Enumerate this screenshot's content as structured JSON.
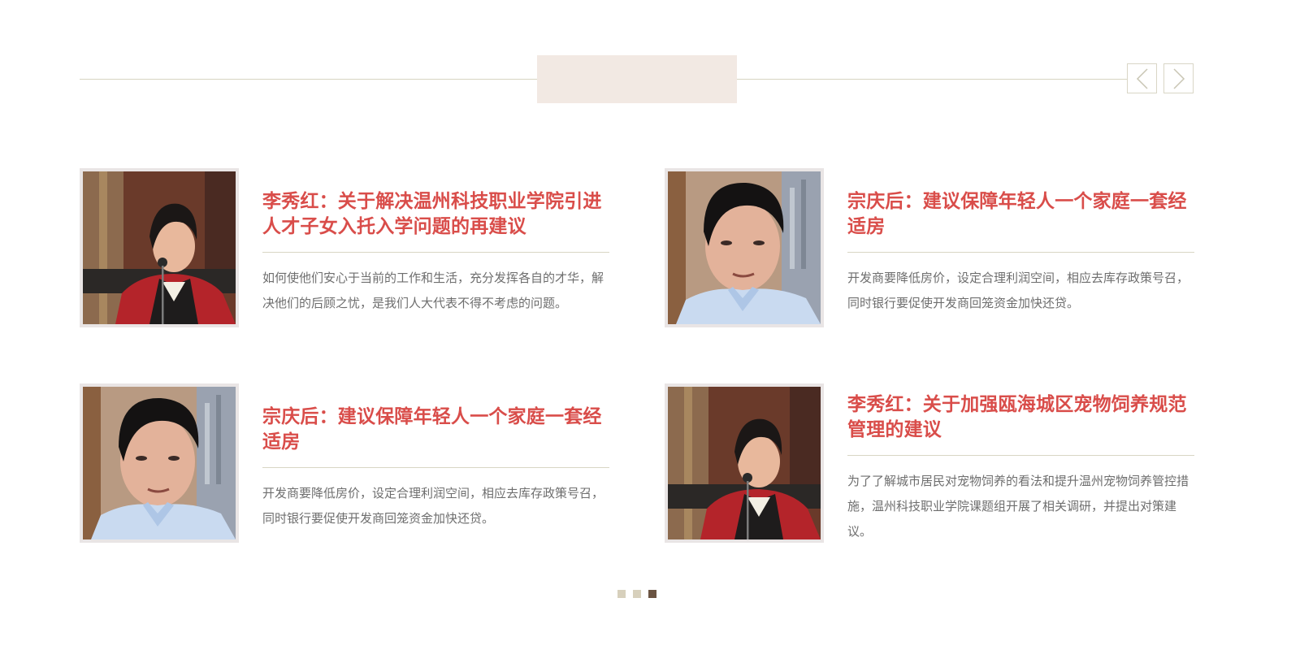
{
  "section": {
    "header_title": ""
  },
  "navigation": {
    "prev_icon": "chevron-left-icon",
    "next_icon": "chevron-right-icon"
  },
  "cards": [
    {
      "photo": "portrait-woman-red-jacket",
      "title": "李秀红：关于解决温州科技职业学院引进人才子女入托入学问题的再建议",
      "description": "如何使他们安心于当前的工作和生活，充分发挥各自的才华，解决他们的后顾之忧，是我们人大代表不得不考虑的问题。"
    },
    {
      "photo": "portrait-man-blue-shirt",
      "title": "宗庆后：建议保障年轻人一个家庭一套经适房",
      "description": "开发商要降低房价，设定合理利润空间，相应去库存政策号召，同时银行要促使开发商回笼资金加快还贷。"
    },
    {
      "photo": "portrait-man-blue-shirt",
      "title": "宗庆后：建议保障年轻人一个家庭一套经适房",
      "description": "开发商要降低房价，设定合理利润空间，相应去库存政策号召，同时银行要促使开发商回笼资金加快还贷。"
    },
    {
      "photo": "portrait-woman-red-jacket",
      "title": "李秀红：关于加强瓯海城区宠物饲养规范管理的建议",
      "description": "为了了解城市居民对宠物饲养的看法和提升温州宠物饲养管控措施，温州科技职业学院课题组开展了相关调研，并提出对策建议。"
    }
  ],
  "pagination": {
    "total_pages": 3,
    "active_page": 3
  },
  "colors": {
    "title_red": "#d94d4a",
    "text_gray": "#6e6e6e",
    "line": "#d7d4c1",
    "header_box": "#f2e9e3",
    "dot_inactive": "#d7d0bc",
    "dot_active": "#6b5443"
  }
}
